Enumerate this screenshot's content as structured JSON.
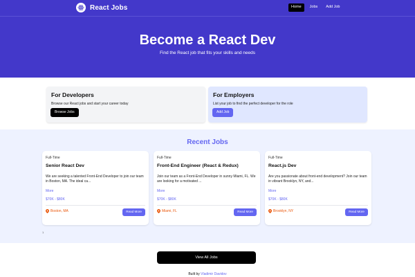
{
  "nav": {
    "brand": "React Jobs",
    "links": [
      "Home",
      "Jobs",
      "Add Job"
    ]
  },
  "hero": {
    "title": "Become a React Dev",
    "subtitle": "Find the React job that fits your skills and needs"
  },
  "cards": [
    {
      "title": "For Developers",
      "text": "Browse our React jobs and start your career today",
      "button": "Browse Jobs"
    },
    {
      "title": "For Employers",
      "text": "List your job to find the perfect developer for the role",
      "button": "Add Job"
    }
  ],
  "recent": {
    "heading": "Recent Jobs",
    "jobs": [
      {
        "type": "Full-Time",
        "title": "Senior React Dev",
        "desc": "We are seeking a talented Front-End Developer to join our team in Boston, MA. The ideal ca...",
        "more": "More",
        "salary": "$70K - $80K",
        "location": "Boston, MA",
        "button": "Read More"
      },
      {
        "type": "Full-Time",
        "title": "Front-End Engineer (React & Redux)",
        "desc": "Join our team as a Front-End Developer in sunny Miami, FL. We are looking for a motivated ...",
        "more": "More",
        "salary": "$70K - $80K",
        "location": "Miami, FL",
        "button": "Read More"
      },
      {
        "type": "Full-Time",
        "title": "React.js Dev",
        "desc": "Are you passionate about front-end development? Join our team in vibrant Brooklyn, NY, and...",
        "more": "More",
        "salary": "$70K - $80K",
        "location": "Brooklyn, NY",
        "button": "Read More"
      }
    ],
    "mark": "1"
  },
  "view_all": "View All Jobs",
  "footer": {
    "prefix": "Built by",
    "author": "Vladimir Davidov"
  },
  "colors": {
    "primary": "#4338ca",
    "accent": "#6366f1",
    "location": "#ea580c"
  }
}
